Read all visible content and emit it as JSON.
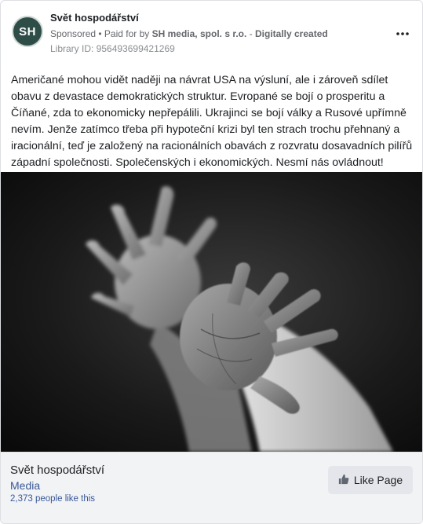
{
  "ad": {
    "page_name": "Svět hospodářství",
    "avatar_text": "SH",
    "sponsored_label": "Sponsored",
    "separator": " • ",
    "paid_prefix": "Paid for by ",
    "payer": "SH media, spol. s r.o.",
    "dash": " - ",
    "created_label": "Digitally created",
    "library_id": "Library ID: 956493699421269",
    "more_icon": "more-options-icon",
    "body_text": "Američané mohou vidět naději na návrat USA na výsluní, ale i zároveň sdílet obavu z devastace demokratických struktur. Evropané se bojí o prosperitu a Číňané, zda to ekonomicky nepřepálili. Ukrajinci se bojí války a Rusové upřímně nevím. Jenže zatímco třeba při hypoteční krizi byl ten strach trochu přehnaný a iracionální, teď je založený na racionálních obavách z rozvratu dosavadních pilířů západní společnosti. Společenských i ekonomických. Nesmí nás ovládnout!"
  },
  "footer": {
    "page_name": "Svět hospodářství",
    "category": "Media",
    "likes": "2,373 people like this",
    "like_button_label": "Like Page",
    "like_icon": "thumbs-up-icon"
  },
  "colors": {
    "avatar_bg": "#2f4d47",
    "link": "#385898",
    "footer_bg": "#f2f3f5"
  }
}
